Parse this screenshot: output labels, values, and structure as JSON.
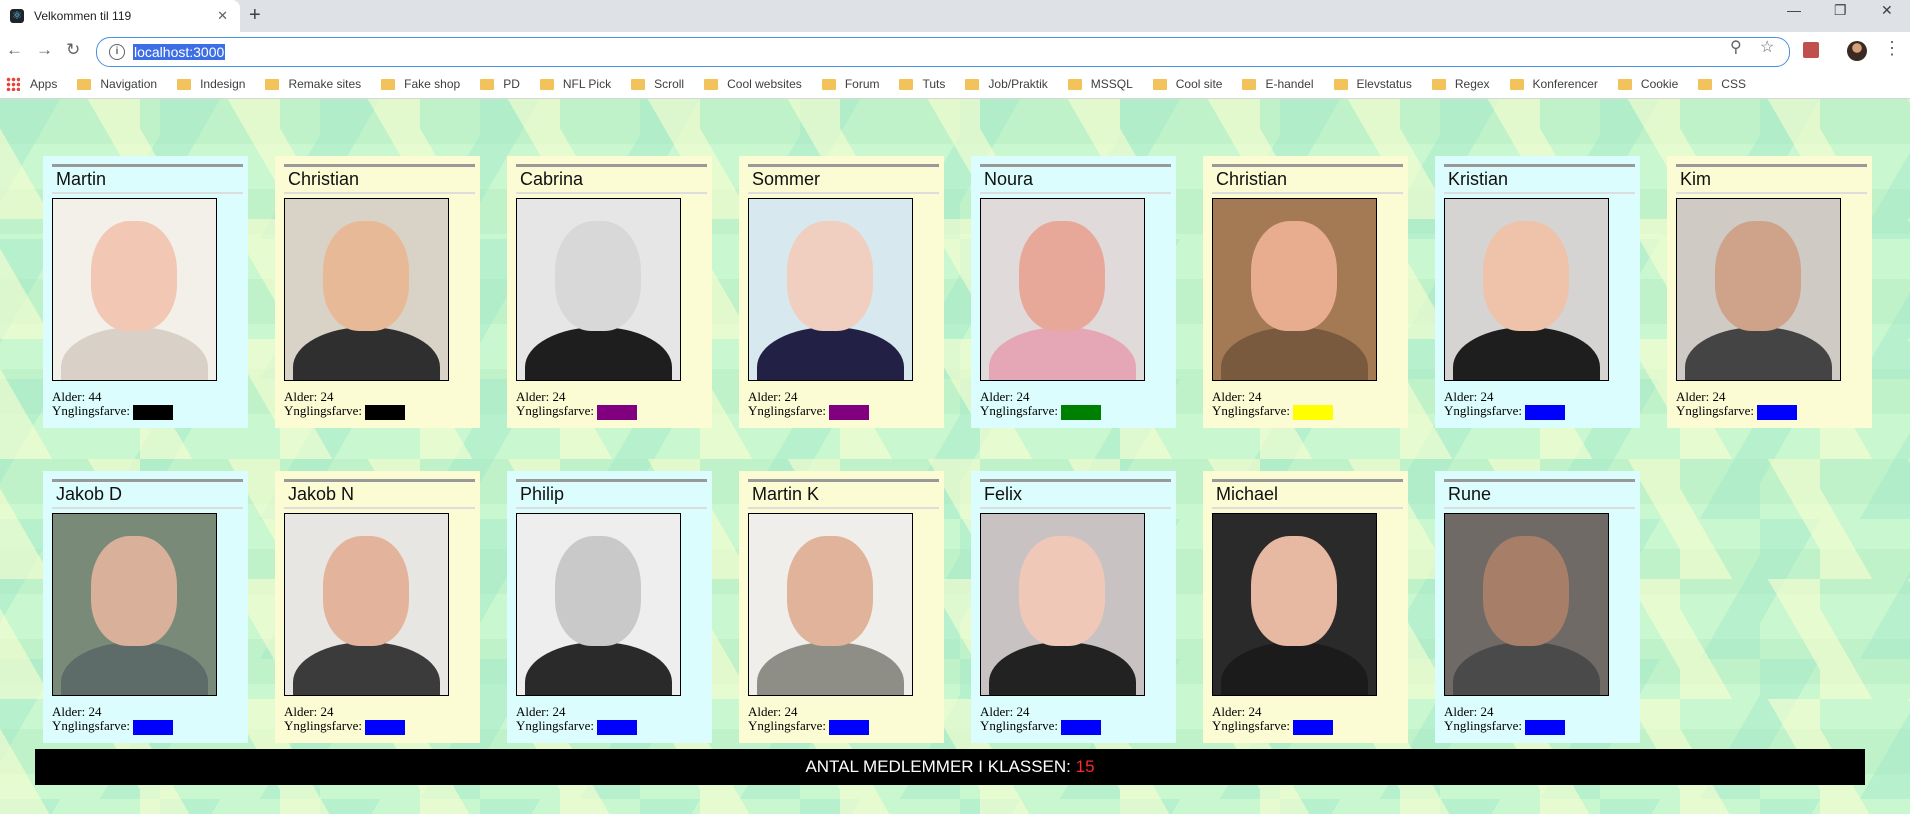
{
  "browser": {
    "tab_title": "Velkommen til 119",
    "url": "localhost:3000",
    "bookmarks": [
      "Apps",
      "Navigation",
      "Indesign",
      "Remake sites",
      "Fake shop",
      "PD",
      "NFL Pick",
      "Scroll",
      "Cool websites",
      "Forum",
      "Tuts",
      "Job/Praktik",
      "MSSQL",
      "Cool site",
      "E-handel",
      "Elevstatus",
      "Regex",
      "Konferencer",
      "Cookie",
      "CSS"
    ]
  },
  "labels": {
    "age_prefix": "Alder:",
    "color_prefix": "Ynglingsfarve:"
  },
  "members": [
    {
      "name": "Martin",
      "age": "44",
      "color": "#000000",
      "bg": "cyan",
      "skin": "#f2c7b3",
      "wear": "#d9d0c8",
      "backdrop": "#f3f0ea"
    },
    {
      "name": "Christian",
      "age": "24",
      "color": "#000000",
      "bg": "cream",
      "skin": "#e8b997",
      "wear": "#2f2f2f",
      "backdrop": "#d9d2c6"
    },
    {
      "name": "Cabrina",
      "age": "24",
      "color": "#800080",
      "bg": "cream",
      "skin": "#d8d8d8",
      "wear": "#1e1e1e",
      "backdrop": "#e6e6e6"
    },
    {
      "name": "Sommer",
      "age": "24",
      "color": "#800080",
      "bg": "cream",
      "skin": "#f0cfc0",
      "wear": "#232045",
      "backdrop": "#d8e8ef"
    },
    {
      "name": "Noura",
      "age": "24",
      "color": "#008000",
      "bg": "cyan",
      "skin": "#e7a89a",
      "wear": "#e5a7b5",
      "backdrop": "#e1dada"
    },
    {
      "name": "Christian",
      "age": "24",
      "color": "#ffff00",
      "bg": "cream",
      "skin": "#e7ad8e",
      "wear": "#7a5a3e",
      "backdrop": "#a47a55"
    },
    {
      "name": "Kristian",
      "age": "24",
      "color": "#0000ff",
      "bg": "cyan",
      "skin": "#efc3aa",
      "wear": "#1e1e1e",
      "backdrop": "#d6d4d2"
    },
    {
      "name": "Kim",
      "age": "24",
      "color": "#0000ff",
      "bg": "cream",
      "skin": "#cfa38a",
      "wear": "#444",
      "backdrop": "#cfcac4"
    },
    {
      "name": "Jakob D",
      "age": "24",
      "color": "#0000ff",
      "bg": "cyan",
      "skin": "#d9b09a",
      "wear": "#5d6b69",
      "backdrop": "#7a8a78"
    },
    {
      "name": "Jakob N",
      "age": "24",
      "color": "#0000ff",
      "bg": "cream",
      "skin": "#e3b49b",
      "wear": "#3b3b3b",
      "backdrop": "#e8e6e2"
    },
    {
      "name": "Philip",
      "age": "24",
      "color": "#0000ff",
      "bg": "cyan",
      "skin": "#c9c9c9",
      "wear": "#2a2a2a",
      "backdrop": "#eeeeee"
    },
    {
      "name": "Martin K",
      "age": "24",
      "color": "#0000ff",
      "bg": "cream",
      "skin": "#e0b39a",
      "wear": "#8e8e86",
      "backdrop": "#f0eeea"
    },
    {
      "name": "Felix",
      "age": "24",
      "color": "#0000ff",
      "bg": "cyan",
      "skin": "#f0c8b8",
      "wear": "#222",
      "backdrop": "#c9c2c2"
    },
    {
      "name": "Michael",
      "age": "24",
      "color": "#0000ff",
      "bg": "cream",
      "skin": "#e8b9a2",
      "wear": "#1b1b1b",
      "backdrop": "#2a2a2a"
    },
    {
      "name": "Rune",
      "age": "24",
      "color": "#0000ff",
      "bg": "cyan",
      "skin": "#a77e68",
      "wear": "#4a4a4a",
      "backdrop": "#6f6a66"
    }
  ],
  "footer": {
    "label": "ANTAL MEDLEMMER I KLASSEN:",
    "count": "15"
  }
}
